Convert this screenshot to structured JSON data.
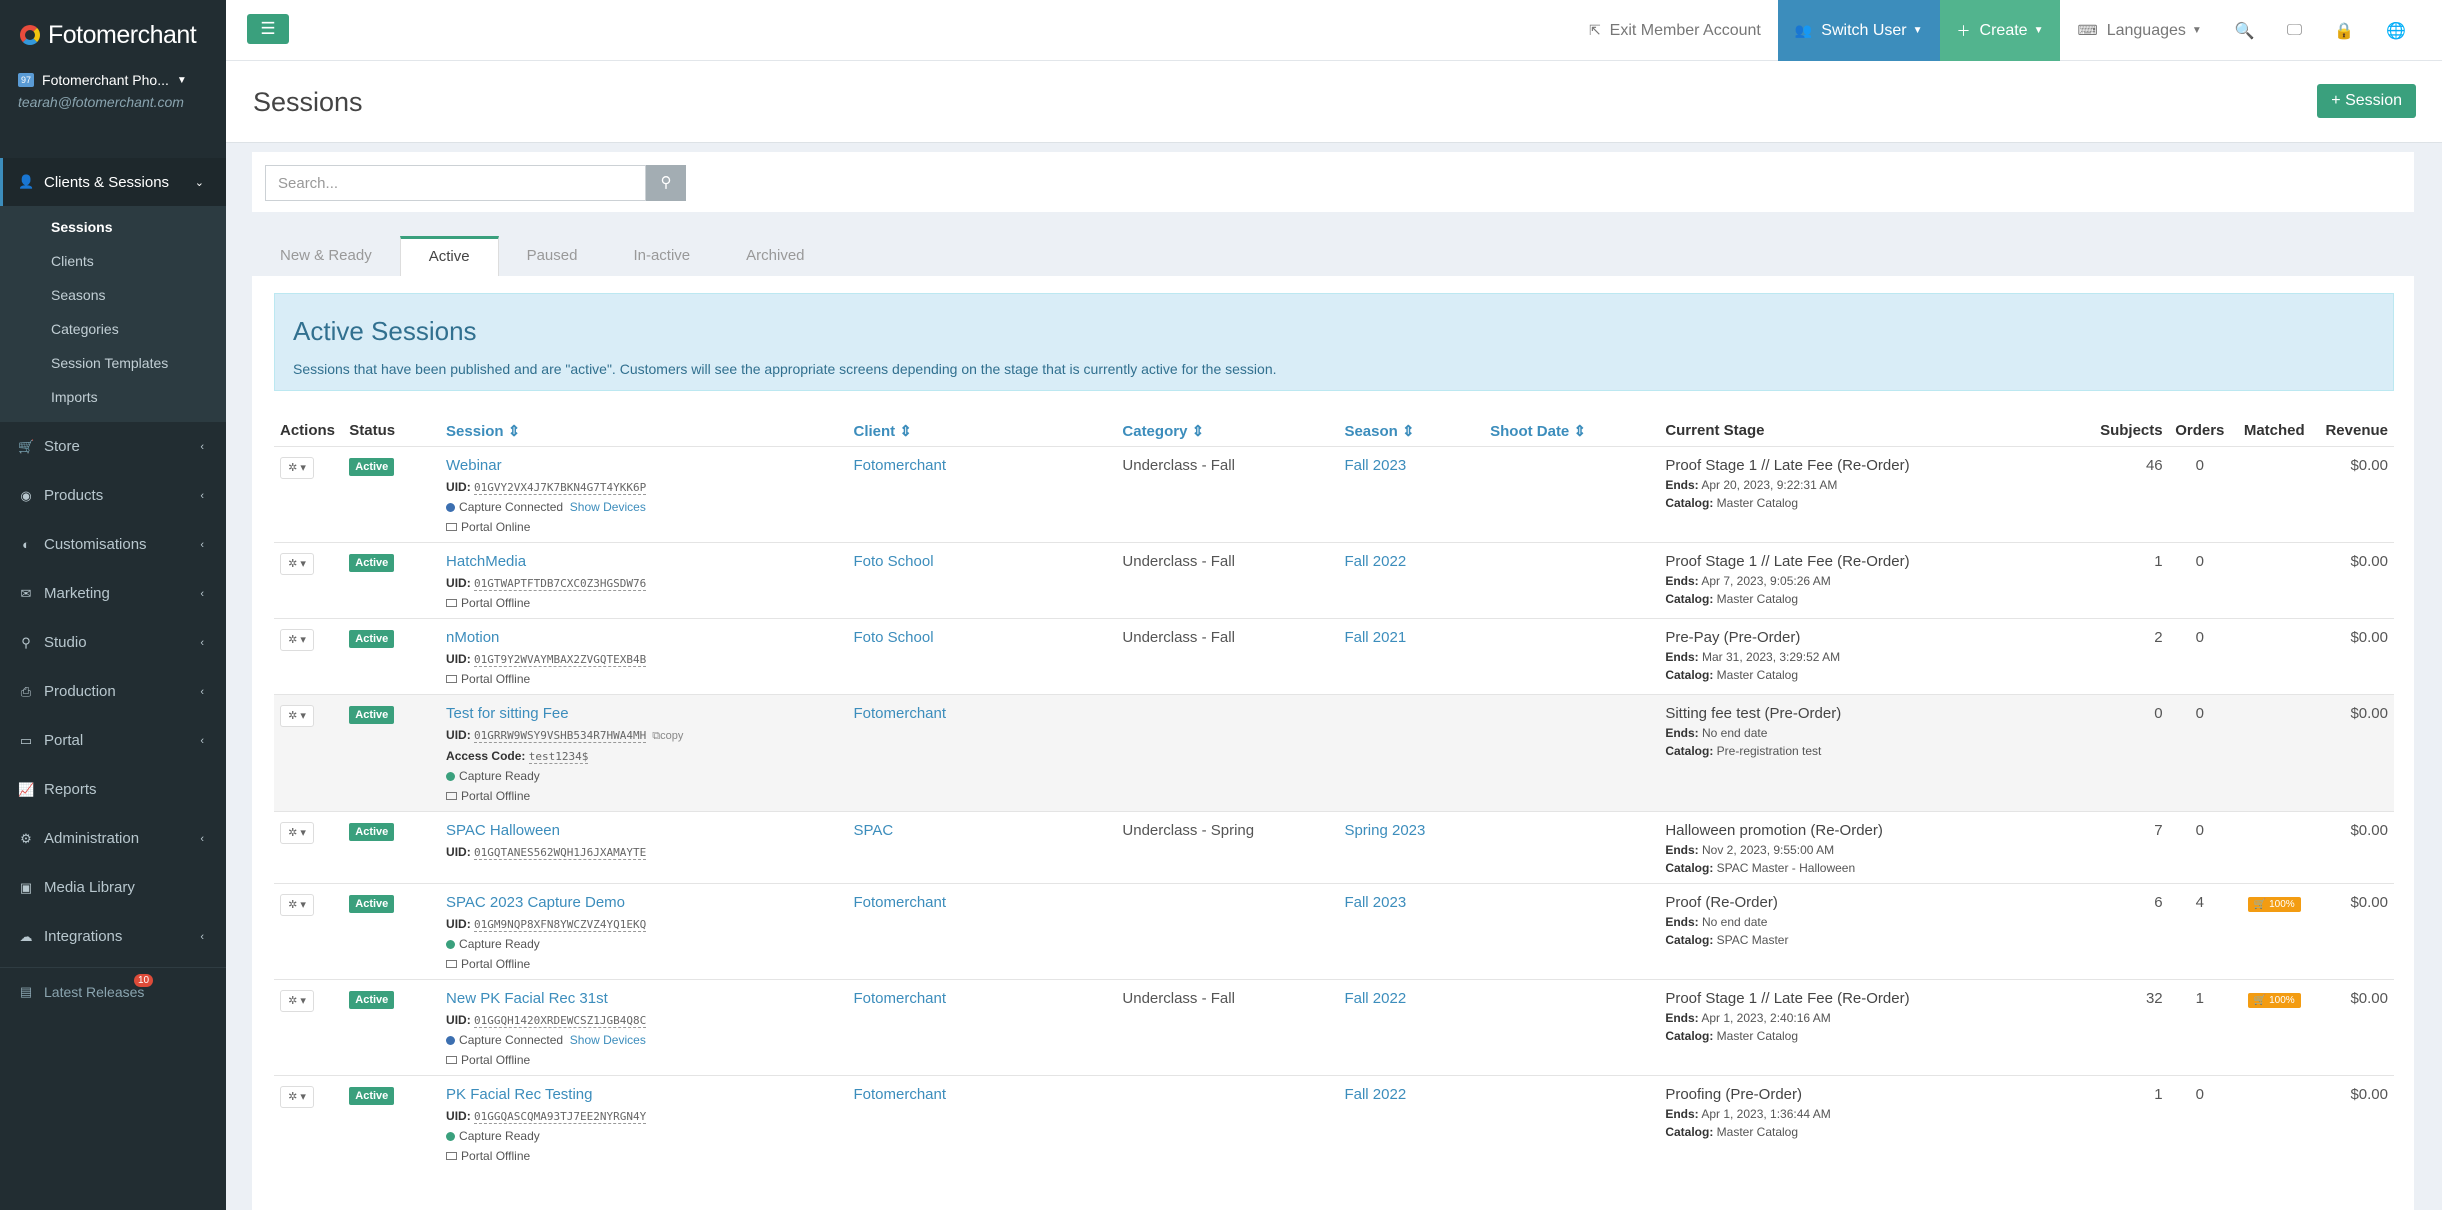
{
  "brand": "Fotomerchant",
  "account": {
    "badge": "97",
    "name": "Fotomerchant Pho...",
    "email": "tearah@fotomerchant.com"
  },
  "sidebar": {
    "section": "Clients & Sessions",
    "subitems": [
      "Sessions",
      "Clients",
      "Seasons",
      "Categories",
      "Session Templates",
      "Imports"
    ],
    "items": [
      "Store",
      "Products",
      "Customisations",
      "Marketing",
      "Studio",
      "Production",
      "Portal",
      "Reports",
      "Administration",
      "Media Library",
      "Integrations"
    ],
    "latest": "Latest Releases",
    "latest_count": "10"
  },
  "topbar": {
    "exit": "Exit Member Account",
    "switch_user": "Switch User",
    "create": "Create",
    "languages": "Languages"
  },
  "page": {
    "title": "Sessions",
    "add_session": "Session"
  },
  "search": {
    "placeholder": "Search..."
  },
  "tabs": [
    "New & Ready",
    "Active",
    "Paused",
    "In-active",
    "Archived"
  ],
  "callout": {
    "title": "Active Sessions",
    "text": "Sessions that have been published and are \"active\". Customers will see the appropriate screens depending on the stage that is currently active for the session."
  },
  "columns": [
    "Actions",
    "Status",
    "Session",
    "Client",
    "Category",
    "Season",
    "Shoot Date",
    "Current Stage",
    "Subjects",
    "Orders",
    "Matched",
    "Revenue"
  ],
  "labels": {
    "uid": "UID:",
    "access": "Access Code:",
    "ends": "Ends:",
    "catalog": "Catalog:",
    "show_devices": "Show Devices",
    "copy": "copy"
  },
  "rows": [
    {
      "status": "Active",
      "session": "Webinar",
      "uid": "01GVY2VX4J7K7BKN4G7T4YKK6P",
      "lines": [
        {
          "type": "dot",
          "color": "#3c6fb0",
          "text": "Capture Connected",
          "devices": true
        },
        {
          "type": "mon",
          "text": "Portal Online"
        }
      ],
      "client": "Fotomerchant",
      "category": "Underclass - Fall",
      "season": "Fall 2023",
      "stage": "Proof Stage 1 // Late Fee (Re-Order)",
      "ends": "Apr 20, 2023, 9:22:31 AM",
      "catalog": "Master Catalog",
      "subjects": "46",
      "orders": "0",
      "matched": "",
      "revenue": "$0.00"
    },
    {
      "status": "Active",
      "session": "HatchMedia",
      "uid": "01GTWAPTFTDB7CXC0Z3HGSDW76",
      "lines": [
        {
          "type": "mon",
          "text": "Portal Offline"
        }
      ],
      "client": "Foto School",
      "category": "Underclass - Fall",
      "season": "Fall 2022",
      "stage": "Proof Stage 1 // Late Fee (Re-Order)",
      "ends": "Apr 7, 2023, 9:05:26 AM",
      "catalog": "Master Catalog",
      "subjects": "1",
      "orders": "0",
      "matched": "",
      "revenue": "$0.00"
    },
    {
      "status": "Active",
      "session": "nMotion",
      "uid": "01GT9Y2WVAYMBAX2ZVGQTEXB4B",
      "lines": [
        {
          "type": "mon",
          "text": "Portal Offline"
        }
      ],
      "client": "Foto School",
      "category": "Underclass - Fall",
      "season": "Fall 2021",
      "stage": "Pre-Pay (Pre-Order)",
      "ends": "Mar 31, 2023, 3:29:52 AM",
      "catalog": "Master Catalog",
      "subjects": "2",
      "orders": "0",
      "matched": "",
      "revenue": "$0.00"
    },
    {
      "status": "Active",
      "session": "Test for sitting Fee",
      "uid": "01GRRW9WSY9VSHB534R7HWA4MH",
      "copy": true,
      "access": "test1234$",
      "lines": [
        {
          "type": "dot",
          "color": "#3aa07d",
          "text": "Capture Ready"
        },
        {
          "type": "mon",
          "text": "Portal Offline"
        }
      ],
      "client": "Fotomerchant",
      "category": "",
      "season": "",
      "stage": "Sitting fee test (Pre-Order)",
      "ends": "No end date",
      "catalog": "Pre-registration test",
      "subjects": "0",
      "orders": "0",
      "matched": "",
      "revenue": "$0.00",
      "hl": true
    },
    {
      "status": "Active",
      "session": "SPAC Halloween",
      "uid": "01GQTANES562WQH1J6JXAMAYTE",
      "lines": [],
      "client": "SPAC",
      "category": "Underclass - Spring",
      "season": "Spring 2023",
      "stage": "Halloween promotion (Re-Order)",
      "ends": "Nov 2, 2023, 9:55:00 AM",
      "catalog": "SPAC Master - Halloween",
      "subjects": "7",
      "orders": "0",
      "matched": "",
      "revenue": "$0.00"
    },
    {
      "status": "Active",
      "session": "SPAC 2023 Capture Demo",
      "uid": "01GM9NQP8XFN8YWCZVZ4YQ1EKQ",
      "lines": [
        {
          "type": "dot",
          "color": "#3aa07d",
          "text": "Capture Ready"
        },
        {
          "type": "mon",
          "text": "Portal Offline"
        }
      ],
      "client": "Fotomerchant",
      "category": "",
      "season": "Fall 2023",
      "stage": "Proof (Re-Order)",
      "ends": "No end date",
      "catalog": "SPAC Master",
      "subjects": "6",
      "orders": "4",
      "matched": "100%",
      "revenue": "$0.00"
    },
    {
      "status": "Active",
      "session": "New PK Facial Rec 31st",
      "uid": "01GGQH1420XRDEWCSZ1JGB4Q8C",
      "lines": [
        {
          "type": "dot",
          "color": "#3c6fb0",
          "text": "Capture Connected",
          "devices": true
        },
        {
          "type": "mon",
          "text": "Portal Offline"
        }
      ],
      "client": "Fotomerchant",
      "category": "Underclass - Fall",
      "season": "Fall 2022",
      "stage": "Proof Stage 1 // Late Fee (Re-Order)",
      "ends": "Apr 1, 2023, 2:40:16 AM",
      "catalog": "Master Catalog",
      "subjects": "32",
      "orders": "1",
      "matched": "100%",
      "revenue": "$0.00"
    },
    {
      "status": "Active",
      "session": "PK Facial Rec Testing",
      "uid": "01GGQASCQMA93TJ7EE2NYRGN4Y",
      "lines": [
        {
          "type": "dot",
          "color": "#3aa07d",
          "text": "Capture Ready"
        },
        {
          "type": "mon",
          "text": "Portal Offline"
        }
      ],
      "client": "Fotomerchant",
      "category": "",
      "season": "Fall 2022",
      "stage": "Proofing (Pre-Order)",
      "ends": "Apr 1, 2023, 1:36:44 AM",
      "catalog": "Master Catalog",
      "subjects": "1",
      "orders": "0",
      "matched": "",
      "revenue": "$0.00"
    }
  ]
}
